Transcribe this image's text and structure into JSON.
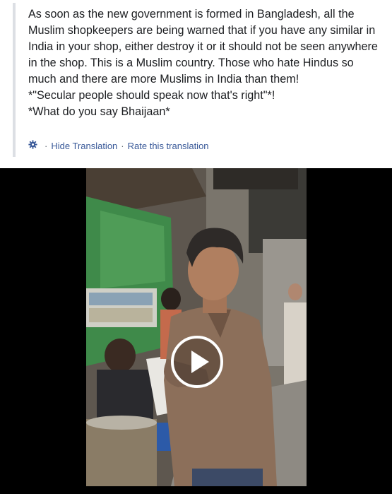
{
  "post": {
    "lines": [
      "As soon as the new government is formed in Bangladesh, all the Muslim shopkeepers are being warned that if you have any similar in India in your shop, either destroy it or it should not be seen anywhere in the shop. This is a Muslim country. Those who hate Hindus so much and there are more Muslims in India than them!",
      "*\"Secular people should speak now that's right\"*!",
      "*What do you say Bhaijaan*"
    ]
  },
  "translation": {
    "icon": "gear-icon",
    "separator": "·",
    "hide_label": "Hide Translation",
    "rate_label": "Rate this translation"
  },
  "video": {
    "play_icon": "play-icon"
  },
  "colors": {
    "text": "#1c1e21",
    "link": "#385898",
    "quote_bar": "#dcdfe4",
    "video_bg": "#000000"
  }
}
